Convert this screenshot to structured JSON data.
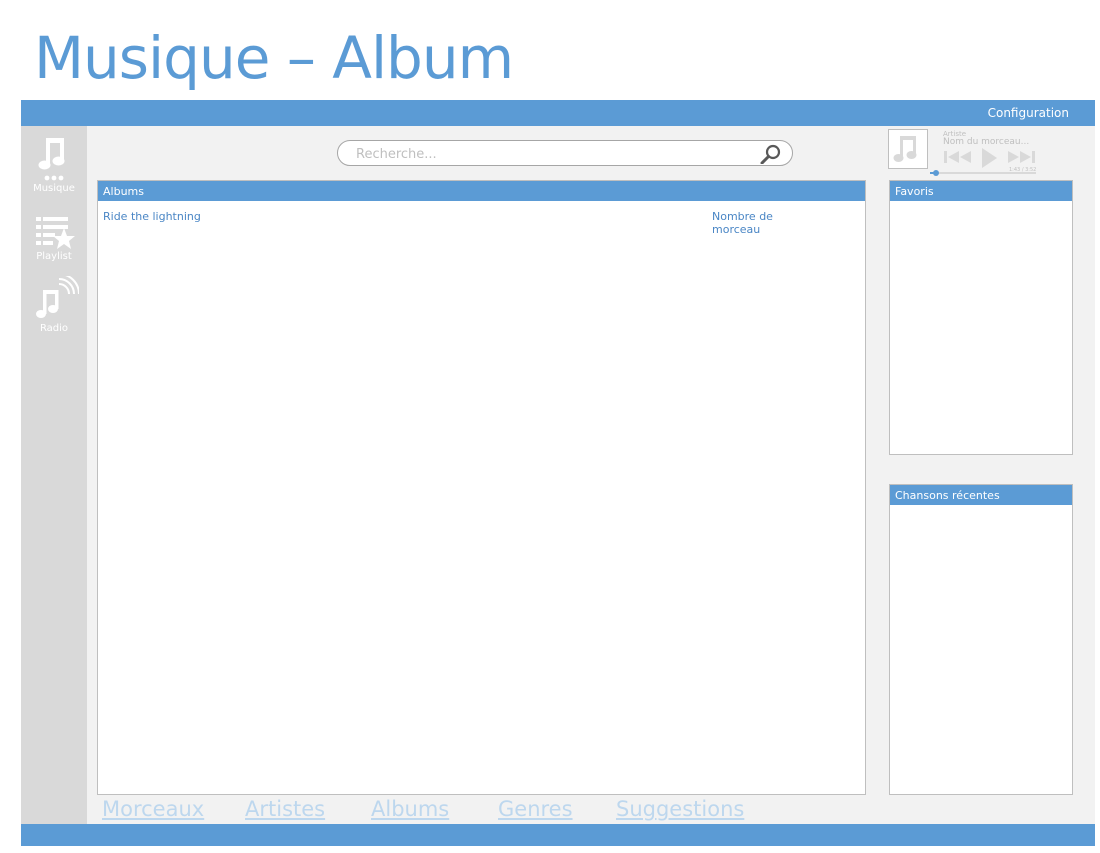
{
  "page_title": "Musique – Album",
  "topbar": {
    "config_label": "Configuration"
  },
  "sidebar": {
    "items": [
      {
        "label": "Musique",
        "icon": "music-note-icon"
      },
      {
        "label": "Playlist",
        "icon": "playlist-star-icon"
      },
      {
        "label": "Radio",
        "icon": "radio-broadcast-icon"
      }
    ]
  },
  "search": {
    "placeholder": "Recherche..."
  },
  "player": {
    "artist": "Artiste",
    "track": "Nom du morceau...",
    "time": "1:43 / 3:52",
    "progress": 0.06
  },
  "albums_panel": {
    "title": "Albums",
    "rows": [
      {
        "name": "Ride the lightning",
        "count": "Nombre de morceau"
      }
    ]
  },
  "favoris_panel": {
    "title": "Favoris"
  },
  "recent_panel": {
    "title": "Chansons récentes"
  },
  "bottom_tabs": [
    "Morceaux",
    "Artistes",
    "Albums",
    "Genres",
    "Suggestions"
  ],
  "colors": {
    "accent": "#5b9bd5",
    "sidebar": "#d9d9d9",
    "background": "#f2f2f2",
    "link": "#4a86c5",
    "tab_link": "#bdd7ee"
  }
}
